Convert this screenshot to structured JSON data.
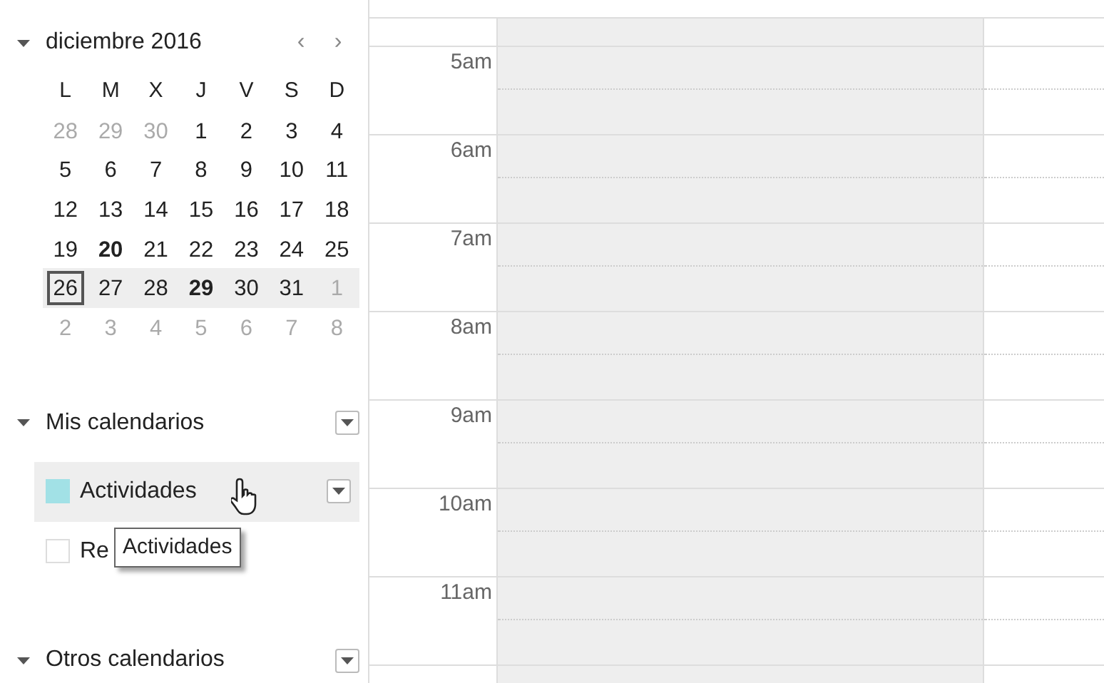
{
  "mini_calendar": {
    "title": "diciembre 2016",
    "prev": "‹",
    "next": "›",
    "weekdays": [
      "L",
      "M",
      "X",
      "J",
      "V",
      "S",
      "D"
    ],
    "weeks": [
      {
        "selected": false,
        "days": [
          {
            "label": "28",
            "other_month": true,
            "bold": false,
            "selected": false
          },
          {
            "label": "29",
            "other_month": true,
            "bold": false,
            "selected": false
          },
          {
            "label": "30",
            "other_month": true,
            "bold": false,
            "selected": false
          },
          {
            "label": "1",
            "other_month": false,
            "bold": false,
            "selected": false
          },
          {
            "label": "2",
            "other_month": false,
            "bold": false,
            "selected": false
          },
          {
            "label": "3",
            "other_month": false,
            "bold": false,
            "selected": false
          },
          {
            "label": "4",
            "other_month": false,
            "bold": false,
            "selected": false
          }
        ]
      },
      {
        "selected": false,
        "days": [
          {
            "label": "5",
            "other_month": false,
            "bold": false,
            "selected": false
          },
          {
            "label": "6",
            "other_month": false,
            "bold": false,
            "selected": false
          },
          {
            "label": "7",
            "other_month": false,
            "bold": false,
            "selected": false
          },
          {
            "label": "8",
            "other_month": false,
            "bold": false,
            "selected": false
          },
          {
            "label": "9",
            "other_month": false,
            "bold": false,
            "selected": false
          },
          {
            "label": "10",
            "other_month": false,
            "bold": false,
            "selected": false
          },
          {
            "label": "11",
            "other_month": false,
            "bold": false,
            "selected": false
          }
        ]
      },
      {
        "selected": false,
        "days": [
          {
            "label": "12",
            "other_month": false,
            "bold": false,
            "selected": false
          },
          {
            "label": "13",
            "other_month": false,
            "bold": false,
            "selected": false
          },
          {
            "label": "14",
            "other_month": false,
            "bold": false,
            "selected": false
          },
          {
            "label": "15",
            "other_month": false,
            "bold": false,
            "selected": false
          },
          {
            "label": "16",
            "other_month": false,
            "bold": false,
            "selected": false
          },
          {
            "label": "17",
            "other_month": false,
            "bold": false,
            "selected": false
          },
          {
            "label": "18",
            "other_month": false,
            "bold": false,
            "selected": false
          }
        ]
      },
      {
        "selected": false,
        "days": [
          {
            "label": "19",
            "other_month": false,
            "bold": false,
            "selected": false
          },
          {
            "label": "20",
            "other_month": false,
            "bold": true,
            "selected": false
          },
          {
            "label": "21",
            "other_month": false,
            "bold": false,
            "selected": false
          },
          {
            "label": "22",
            "other_month": false,
            "bold": false,
            "selected": false
          },
          {
            "label": "23",
            "other_month": false,
            "bold": false,
            "selected": false
          },
          {
            "label": "24",
            "other_month": false,
            "bold": false,
            "selected": false
          },
          {
            "label": "25",
            "other_month": false,
            "bold": false,
            "selected": false
          }
        ]
      },
      {
        "selected": true,
        "days": [
          {
            "label": "26",
            "other_month": false,
            "bold": false,
            "selected": true
          },
          {
            "label": "27",
            "other_month": false,
            "bold": false,
            "selected": false
          },
          {
            "label": "28",
            "other_month": false,
            "bold": false,
            "selected": false
          },
          {
            "label": "29",
            "other_month": false,
            "bold": true,
            "selected": false
          },
          {
            "label": "30",
            "other_month": false,
            "bold": false,
            "selected": false
          },
          {
            "label": "31",
            "other_month": false,
            "bold": false,
            "selected": false
          },
          {
            "label": "1",
            "other_month": true,
            "bold": false,
            "selected": false
          }
        ]
      },
      {
        "selected": false,
        "days": [
          {
            "label": "2",
            "other_month": true,
            "bold": false,
            "selected": false
          },
          {
            "label": "3",
            "other_month": true,
            "bold": false,
            "selected": false
          },
          {
            "label": "4",
            "other_month": true,
            "bold": false,
            "selected": false
          },
          {
            "label": "5",
            "other_month": true,
            "bold": false,
            "selected": false
          },
          {
            "label": "6",
            "other_month": true,
            "bold": false,
            "selected": false
          },
          {
            "label": "7",
            "other_month": true,
            "bold": false,
            "selected": false
          },
          {
            "label": "8",
            "other_month": true,
            "bold": false,
            "selected": false
          }
        ]
      }
    ]
  },
  "my_calendars": {
    "title": "Mis calendarios",
    "items": [
      {
        "label": "Actividades",
        "checked": true,
        "color": "#a2e1e6",
        "highlighted": true
      },
      {
        "label": "Re",
        "checked": false,
        "color": "#ffffff",
        "highlighted": false
      }
    ],
    "tooltip": "Actividades"
  },
  "other_calendars": {
    "title": "Otros calendarios"
  },
  "day_view": {
    "hours": [
      "5am",
      "6am",
      "7am",
      "8am",
      "9am",
      "10am",
      "11am"
    ]
  }
}
